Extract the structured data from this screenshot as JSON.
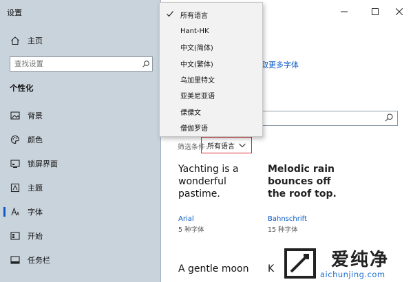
{
  "app": {
    "title": "设置"
  },
  "sidebar": {
    "home_label": "主页",
    "search_placeholder": "查找设置",
    "section_title": "个性化",
    "items": [
      {
        "label": "背景",
        "icon": "image-icon"
      },
      {
        "label": "颜色",
        "icon": "palette-icon"
      },
      {
        "label": "锁屏界面",
        "icon": "lock-screen-icon"
      },
      {
        "label": "主题",
        "icon": "theme-icon"
      },
      {
        "label": "字体",
        "icon": "font-icon",
        "active": true
      },
      {
        "label": "开始",
        "icon": "start-icon"
      },
      {
        "label": "任务栏",
        "icon": "taskbar-icon"
      }
    ]
  },
  "main": {
    "link_more_fonts": "取更多字体",
    "filter_label": "筛选条件:",
    "filter_value": "所有语言",
    "cards": [
      {
        "preview": "Yachting is a wonderful pastime.",
        "name": "Arial",
        "count": "5 种字体"
      },
      {
        "preview": "Melodic rain bounces off the roof top.",
        "name": "Bahnschrift",
        "count": "15 种字体"
      },
      {
        "preview": "A gentle moon",
        "name": "",
        "count": ""
      },
      {
        "preview": "K",
        "name": "",
        "count": ""
      }
    ]
  },
  "dropdown": {
    "selected_index": 0,
    "options": [
      "所有语言",
      "Hant-HK",
      "中文(简体)",
      "中文(繁体)",
      "乌加里特文",
      "亚美尼亚语",
      "傈僳文",
      "僧伽罗语"
    ]
  },
  "watermark": {
    "brand_text": "爱纯净",
    "url": "aichunjing.com"
  },
  "colors": {
    "accent": "#0a5bc4",
    "highlight_box": "#d7262e",
    "sidebar_bg": "#c9d3dc"
  }
}
